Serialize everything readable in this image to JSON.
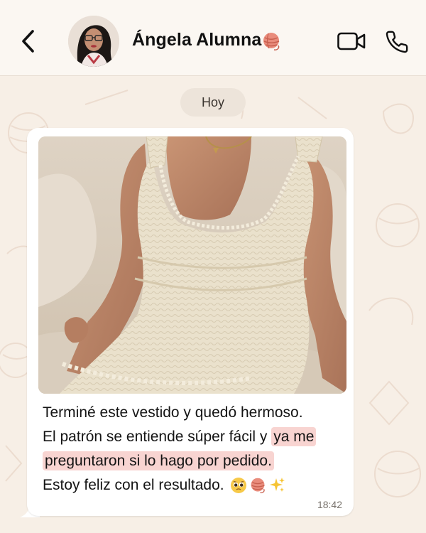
{
  "header": {
    "contact_name": "Ángela Alumna",
    "name_emoji": "yarn-ball-icon",
    "actions": [
      "back-icon",
      "video-camera-icon",
      "phone-icon"
    ]
  },
  "chat": {
    "date_label": "Hoy"
  },
  "message": {
    "line1": "Terminé este vestido y quedó hermoso.",
    "line2_plain": "El patrón se entiende súper fácil y ",
    "line2_highlight": "ya me",
    "line3_highlight": "preguntaron si lo hago por pedido.",
    "line4": "Estoy feliz con el resultado.",
    "emojis": [
      "pleading-face-icon",
      "yarn-ball-icon",
      "sparkles-icon"
    ],
    "time": "18:42"
  },
  "colors": {
    "chat_background": "#f7efe6",
    "header_background": "#fbf7f2",
    "bubble_background": "#ffffff",
    "highlight": "#f8d4d1",
    "date_chip": "#ede4da"
  }
}
